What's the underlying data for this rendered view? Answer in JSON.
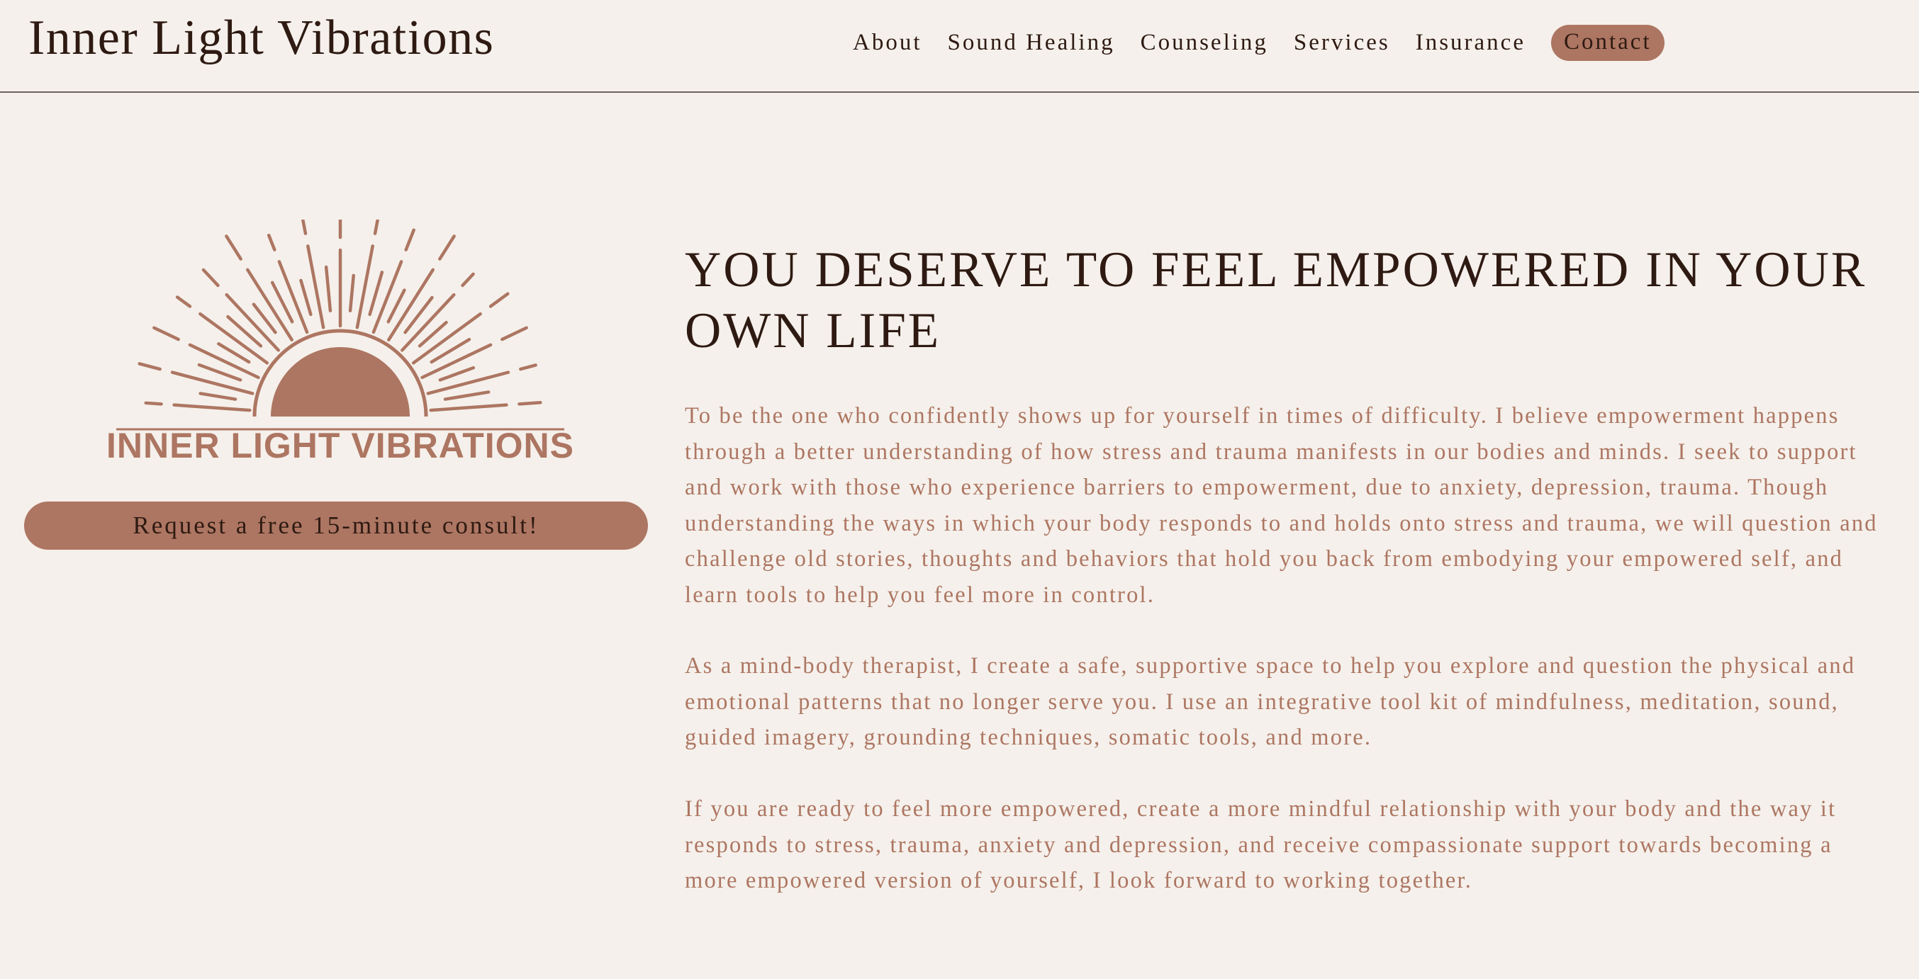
{
  "header": {
    "site_title": "Inner Light Vibrations",
    "nav": [
      {
        "label": "About"
      },
      {
        "label": "Sound Healing"
      },
      {
        "label": "Counseling"
      },
      {
        "label": "Services"
      },
      {
        "label": "Insurance"
      },
      {
        "label": "Contact"
      }
    ]
  },
  "logo": {
    "text": "INNER LIGHT VIBRATIONS",
    "icon": "rising-sun-icon"
  },
  "cta": {
    "label": "Request a free 15-minute consult!"
  },
  "main": {
    "headline": "YOU DESERVE TO FEEL EMPOWERED IN YOUR OWN LIFE",
    "paragraphs": [
      "To be the one who confidently shows up for yourself in times of difficulty. I believe empowerment happens through a better understanding of how stress and trauma manifests in our bodies and minds. I seek to support and work with those who experience barriers to empowerment, due to anxiety, depression, trauma. Though understanding the ways in which your body responds to and holds onto stress and trauma, we will question and challenge old stories, thoughts and behaviors that hold you back from embodying your empowered self, and learn tools to help you feel more in control.",
      "As a mind-body therapist, I create a safe, supportive space to help you explore and question the physical and emotional patterns that no longer serve you. I use an integrative tool kit of mindfulness, meditation, sound, guided imagery, grounding techniques, somatic tools, and more.",
      "If you are ready to feel more empowered, create a more mindful relationship with your body and the way it responds to stress, trauma, anxiety and depression, and receive compassionate support towards becoming a more empowered version of yourself, I look forward to working together."
    ]
  },
  "colors": {
    "background": "#f5f0eb",
    "accent": "#ad7662",
    "text": "#2e1a12"
  }
}
